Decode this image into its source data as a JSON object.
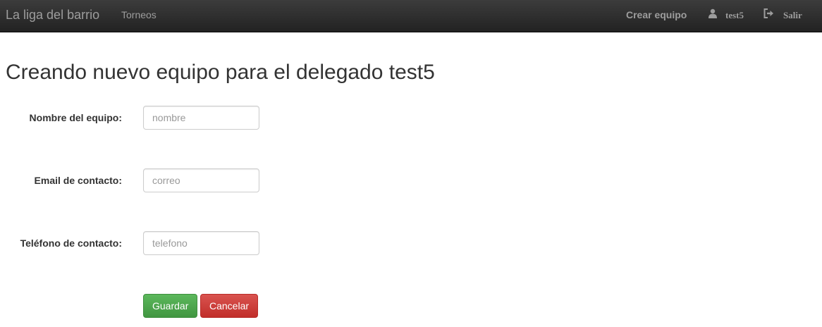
{
  "navbar": {
    "brand": "La liga del barrio",
    "links": [
      {
        "label": "Torneos"
      }
    ],
    "right": {
      "create_team": "Crear equipo",
      "user": "test5",
      "user_icon": "user-icon",
      "logout": "Salir",
      "logout_icon": "logout-icon"
    }
  },
  "main": {
    "title": "Creando nuevo equipo para el delegado test5",
    "form": {
      "fields": [
        {
          "label": "Nombre del equipo:",
          "value": "",
          "placeholder": "nombre"
        },
        {
          "label": "Email de contacto:",
          "value": "",
          "placeholder": "correo"
        },
        {
          "label": "Teléfono de contacto:",
          "value": "",
          "placeholder": "telefono"
        }
      ],
      "save_label": "Guardar",
      "cancel_label": "Cancelar"
    }
  },
  "colors": {
    "navbar": "#222222",
    "save": "#5cb85c",
    "cancel": "#d9534f"
  }
}
